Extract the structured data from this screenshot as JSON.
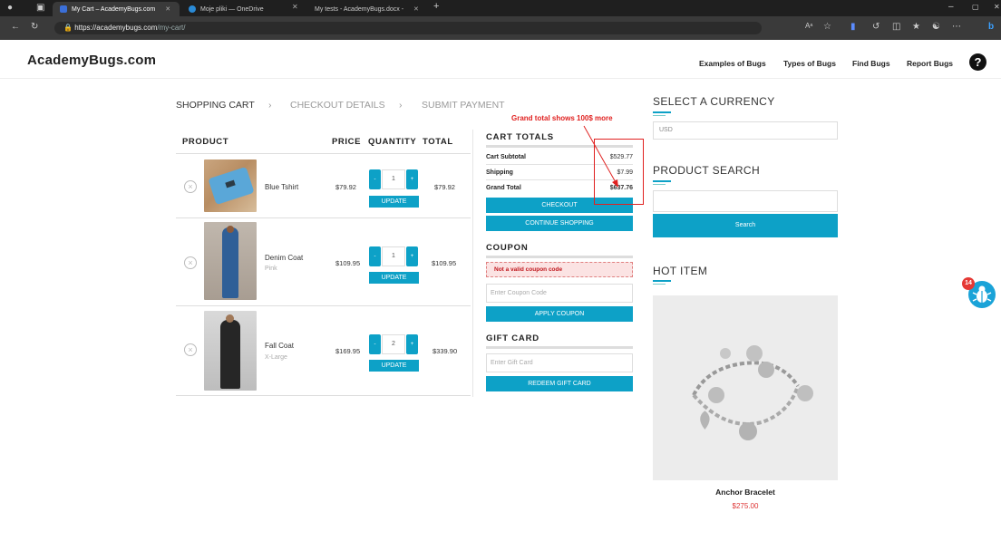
{
  "browser": {
    "tabs": [
      {
        "label": "My Cart – AcademyBugs.com",
        "color": "#3b6fd8"
      },
      {
        "label": "Moje pliki — OneDrive",
        "color": "#2a8ad6"
      },
      {
        "label": "My tests - AcademyBugs.docx -",
        "color": "#2b5cb8"
      }
    ],
    "new_tab": "+",
    "url_host": "https://academybugs.com",
    "url_path": "/my-cart/",
    "read_aloud": "Aᵃ"
  },
  "site": {
    "logo": "AcademyBugs.com",
    "nav": [
      "Examples of Bugs",
      "Types of Bugs",
      "Find Bugs",
      "Report Bugs"
    ],
    "help": "?"
  },
  "steps": [
    "SHOPPING CART",
    "CHECKOUT DETAILS",
    "SUBMIT PAYMENT"
  ],
  "step_sep": "›",
  "cart": {
    "headers": {
      "product": "PRODUCT",
      "price": "PRICE",
      "quantity": "QUANTITY",
      "total": "TOTAL"
    },
    "remove_glyph": "×",
    "minus": "-",
    "plus": "+",
    "update_label": "UPDATE",
    "items": [
      {
        "name": "Blue Tshirt",
        "variant": "",
        "price": "$79.92",
        "qty": "1",
        "total": "$79.92"
      },
      {
        "name": "Denim Coat",
        "variant": "Pink",
        "price": "$109.95",
        "qty": "1",
        "total": "$109.95"
      },
      {
        "name": "Fall Coat",
        "variant": "X-Large",
        "price": "$169.95",
        "qty": "2",
        "total": "$339.90"
      }
    ]
  },
  "totals": {
    "title": "CART TOTALS",
    "subtotal_label": "Cart Subtotal",
    "subtotal": "$529.77",
    "shipping_label": "Shipping",
    "shipping": "$7.99",
    "grand_label": "Grand Total",
    "grand": "$637.76",
    "checkout_label": "CHECKOUT",
    "continue_label": "CONTINUE SHOPPING"
  },
  "coupon": {
    "title": "COUPON",
    "error": "Not a valid coupon code",
    "placeholder": "Enter Coupon Code",
    "apply_label": "APPLY COUPON"
  },
  "gift": {
    "title": "GIFT CARD",
    "placeholder": "Enter Gift Card",
    "redeem_label": "REDEEM GIFT CARD"
  },
  "annotation": {
    "text": "Grand total shows 100$ more"
  },
  "sidebar": {
    "currency_title": "SELECT A CURRENCY",
    "currency_value": "USD",
    "search_title": "PRODUCT SEARCH",
    "search_button": "Search",
    "hot_title": "HOT ITEM",
    "hot_name": "Anchor Bracelet",
    "hot_price": "$275.00"
  },
  "widget": {
    "badge": "14"
  },
  "colors": {
    "accent": "#0da1c7",
    "annotation": "#e0201f",
    "error_bg": "#fbe3e3"
  }
}
